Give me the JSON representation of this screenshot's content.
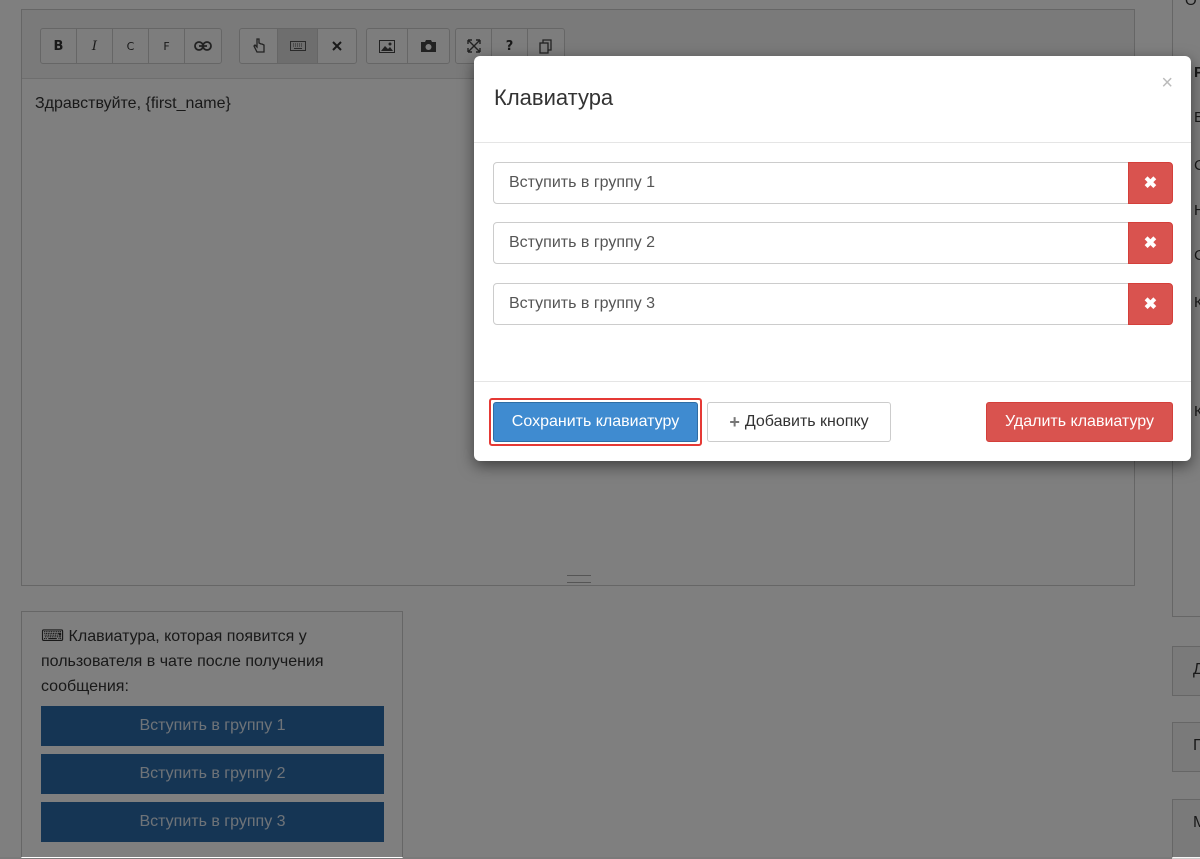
{
  "editor": {
    "toolbar": {
      "bold": "B",
      "italic": "I",
      "c": "C",
      "f": "F",
      "help": "?"
    },
    "content": "Здравствуйте, {first_name}"
  },
  "preview": {
    "icon": "keyboard-icon",
    "icon_glyph": "⌨",
    "text": "Клавиатура, которая появится у пользователя в чате после получения сообщения:",
    "buttons": [
      "Вступить в группу 1",
      "Вступить в группу 2",
      "Вступить в группу 3"
    ]
  },
  "right": {
    "letters": [
      "О",
      "Р",
      "В",
      "С",
      "Н",
      "С",
      "К",
      "К"
    ],
    "tabs": [
      "Д",
      "П",
      "М"
    ]
  },
  "modal": {
    "title": "Клавиатура",
    "close": "×",
    "rows": [
      {
        "value": "Вступить в группу 1"
      },
      {
        "value": "Вступить в группу 2"
      },
      {
        "value": "Вступить в группу 3"
      }
    ],
    "delete_glyph": "✖",
    "save_label": "Сохранить клавиатуру",
    "add_label": "Добавить кнопку",
    "add_glyph": "+",
    "remove_label": "Удалить клавиатуру"
  },
  "colors": {
    "primary": "#3f8bd0",
    "danger": "#d9534f",
    "keyboard_button": "#2b6aa8",
    "highlight": "#e53935"
  }
}
